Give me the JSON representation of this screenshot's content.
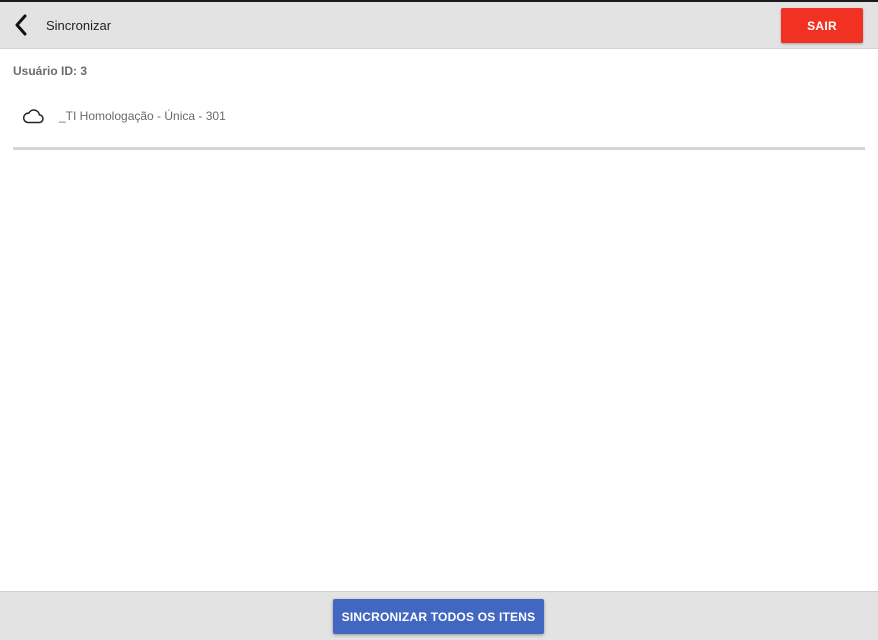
{
  "header": {
    "title": "Sincronizar",
    "back_icon": "chevron-left-icon",
    "exit_label": "SAIR",
    "exit_color": "#f13223"
  },
  "content": {
    "user_id_label": "Usuário ID: 3",
    "items": [
      {
        "icon": "cloud-icon",
        "label": "_TI Homologação - Única - 301"
      }
    ]
  },
  "footer": {
    "sync_all_label": "SINCRONIZAR TODOS OS ITENS",
    "sync_all_color": "#4267c0"
  }
}
